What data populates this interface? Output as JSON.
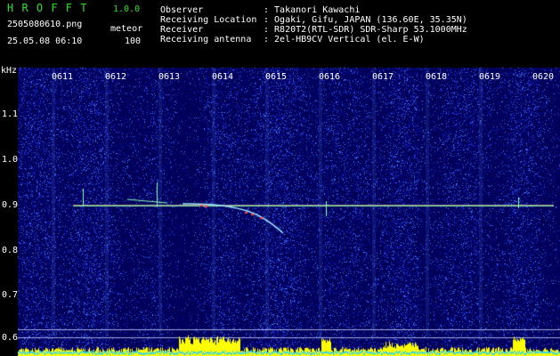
{
  "header": {
    "app_name": "H R O F F T",
    "version": "1.0.0",
    "filename": "2505080610.png",
    "timestamp": "25.05.08 06:10",
    "mode_label": "meteor",
    "mode_value": "100"
  },
  "info": {
    "rows": [
      {
        "label": "Observer",
        "value": ": Takanori Kawachi"
      },
      {
        "label": "Receiving Location",
        "value": ": Ogaki, Gifu, JAPAN (136.60E, 35.35N)"
      },
      {
        "label": "Receiver",
        "value": ": R820T2(RTL-SDR) SDR-Sharp 53.1000MHz"
      },
      {
        "label": "Receiving antenna",
        "value": ": 2el-HB9CV Vertical (el. E-W)"
      }
    ]
  },
  "spectrogram": {
    "unit_label": "kHz",
    "time_labels": [
      "0611",
      "0612",
      "0613",
      "0614",
      "0615",
      "0616",
      "0617",
      "0618",
      "0619",
      "0620"
    ],
    "freq_labels": [
      "1.1",
      "1.0",
      "0.9",
      "0.8",
      "0.7",
      "0.6"
    ],
    "colors": {
      "trace": "#7fe0a0",
      "activity": "#ffff00",
      "background": "#00007a",
      "axis_text": "#ffffff",
      "title_text": "#28e028"
    }
  }
}
